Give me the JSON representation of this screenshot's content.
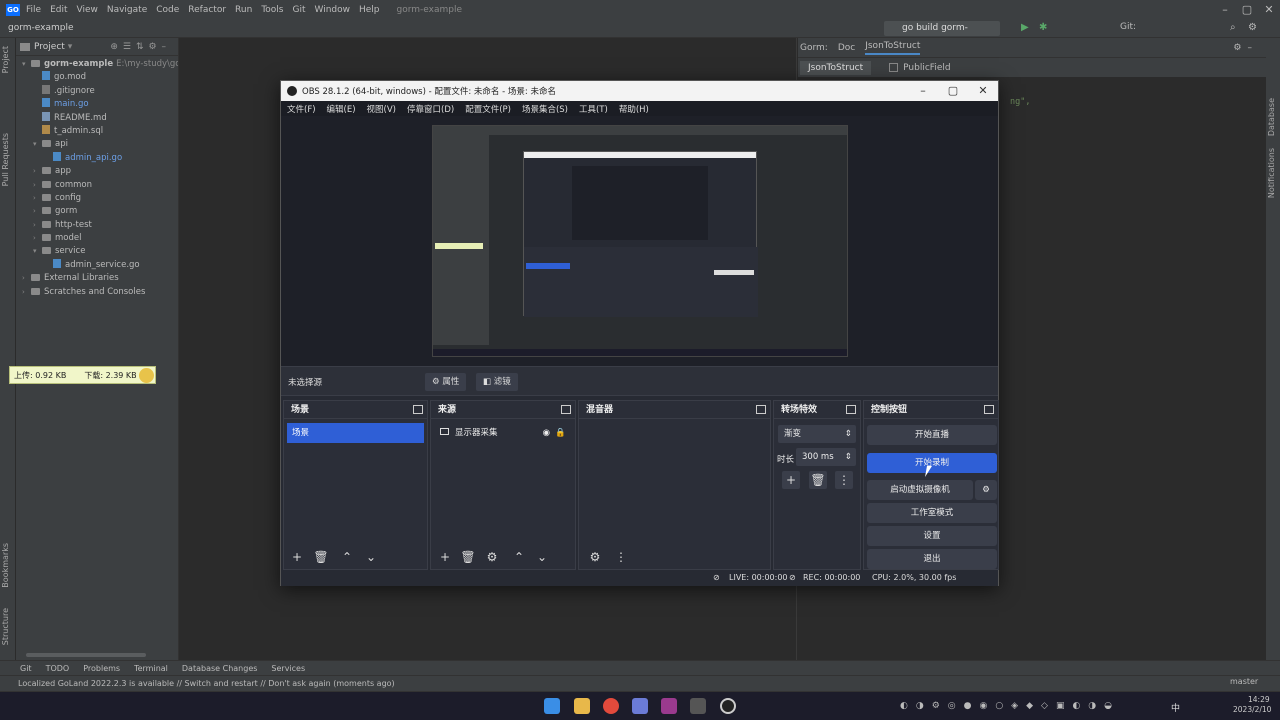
{
  "ide": {
    "menu": [
      "File",
      "Edit",
      "View",
      "Navigate",
      "Code",
      "Refactor",
      "Run",
      "Tools",
      "Git",
      "Window",
      "Help"
    ],
    "project_name": "gorm-example",
    "breadcrumb": "gorm-example",
    "run_config": "go build gorm-example",
    "git_label": "Git:",
    "project_panel_title": "Project",
    "tree": [
      {
        "label": "gorm-example",
        "extra": "E:\\my-study\\gorm",
        "depth": 0,
        "kind": "folder",
        "open": true
      },
      {
        "label": "go.mod",
        "depth": 1,
        "kind": "mod"
      },
      {
        "label": ".gitignore",
        "depth": 1,
        "kind": "git"
      },
      {
        "label": "main.go",
        "depth": 1,
        "kind": "go",
        "blue": true
      },
      {
        "label": "README.md",
        "depth": 1,
        "kind": "md"
      },
      {
        "label": "t_admin.sql",
        "depth": 1,
        "kind": "sql"
      },
      {
        "label": "api",
        "depth": 1,
        "kind": "folder",
        "open": true
      },
      {
        "label": "admin_api.go",
        "depth": 2,
        "kind": "go",
        "blue": true
      },
      {
        "label": "app",
        "depth": 1,
        "kind": "folder"
      },
      {
        "label": "common",
        "depth": 1,
        "kind": "folder"
      },
      {
        "label": "config",
        "depth": 1,
        "kind": "folder"
      },
      {
        "label": "gorm",
        "depth": 1,
        "kind": "folder"
      },
      {
        "label": "http-test",
        "depth": 1,
        "kind": "folder"
      },
      {
        "label": "model",
        "depth": 1,
        "kind": "folder"
      },
      {
        "label": "service",
        "depth": 1,
        "kind": "folder",
        "open": true
      },
      {
        "label": "admin_service.go",
        "depth": 2,
        "kind": "go"
      },
      {
        "label": "External Libraries",
        "depth": 0,
        "kind": "folder"
      },
      {
        "label": "Scratches and Consoles",
        "depth": 0,
        "kind": "folder"
      }
    ],
    "right_tabs": [
      "Gorm:",
      "Doc",
      "JsonToStruct"
    ],
    "right_sub": {
      "button": "JsonToStruct",
      "checkbox": "PublicField"
    },
    "editor_snippet": "ng\",",
    "tool_tabs": [
      "Git",
      "TODO",
      "Problems",
      "Terminal",
      "Database Changes",
      "Services"
    ],
    "status": "Localized GoLand 2022.2.3 is available // Switch and restart // Don't ask again (moments ago)",
    "left_vtabs": [
      "Project",
      "Pull Requests",
      "Bookmarks",
      "Structure"
    ],
    "right_vtabs": [
      "Database",
      "Notifications"
    ]
  },
  "netspeed": {
    "up": "上传: 0.92 KB",
    "down": "下载: 2.39 KB"
  },
  "obs": {
    "title": "OBS 28.1.2 (64-bit, windows) - 配置文件: 未命名 - 场景: 未命名",
    "menu": [
      "文件(F)",
      "编辑(E)",
      "视图(V)",
      "停靠窗口(D)",
      "配置文件(P)",
      "场景集合(S)",
      "工具(T)",
      "帮助(H)"
    ],
    "no_source": "未选择源",
    "props_btn": "属性",
    "filters_btn": "滤镜",
    "scenes_title": "场景",
    "scene_item": "场景",
    "sources_title": "来源",
    "source_item": "显示器采集",
    "mixer_title": "混音器",
    "transitions_title": "转场特效",
    "transition_type": "渐变",
    "duration_label": "时长",
    "duration_value": "300 ms",
    "controls_title": "控制按钮",
    "btn_stream": "开始直播",
    "btn_record": "开始录制",
    "btn_vcam": "启动虚拟摄像机",
    "btn_studio": "工作室模式",
    "btn_settings": "设置",
    "btn_exit": "退出",
    "live": "LIVE: 00:00:00",
    "rec": "REC: 00:00:00",
    "cpu": "CPU: 2.0%, 30.00 fps"
  },
  "tray": {
    "lang": "中",
    "user": "master",
    "time": "14:29",
    "date": "2023/2/10"
  },
  "colors": {
    "accent": "#2f5fd6",
    "obs_bg": "#272a33",
    "ide_bg": "#2b2b2b"
  }
}
